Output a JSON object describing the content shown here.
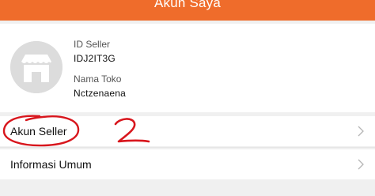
{
  "header": {
    "title": "Akun Saya"
  },
  "profile": {
    "avatar_icon": "store-icon",
    "seller_id_label": "ID Seller",
    "seller_id_value": "IDJ2IT3G",
    "shop_name_label": "Nama Toko",
    "shop_name_value": "Nctzenaena"
  },
  "menu": [
    {
      "label": "Akun Seller",
      "icon": "chevron-right-icon"
    },
    {
      "label": "Informasi Umum",
      "icon": "chevron-right-icon"
    }
  ],
  "annotation": {
    "text": "2",
    "color": "#d8161d"
  },
  "colors": {
    "accent": "#ef6c2b",
    "background": "#f0f0f0"
  }
}
